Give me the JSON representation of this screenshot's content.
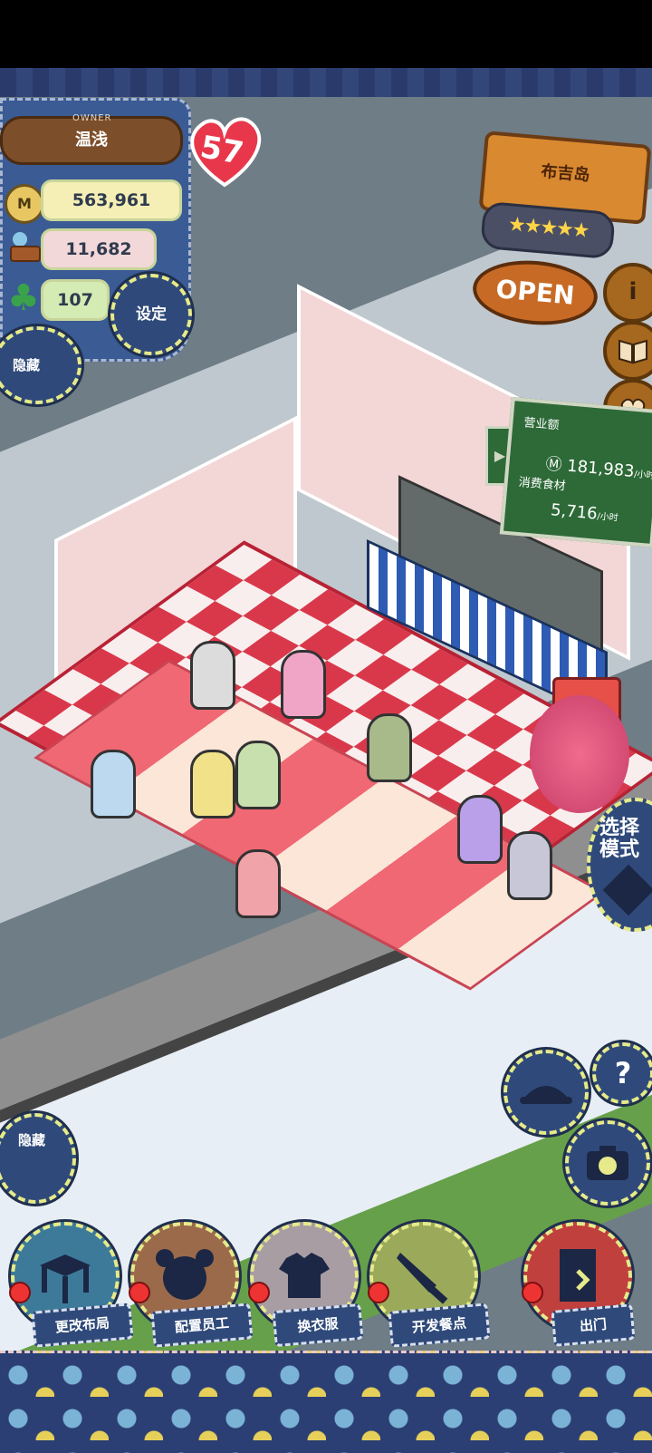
{
  "owner": {
    "label": "OWNER",
    "name": "温浅",
    "hearts": "57",
    "money": "563,961",
    "food": "11,682",
    "clover": "107"
  },
  "buttons": {
    "settings": "设定",
    "hide_top": "隐藏",
    "hide_bottom": "隐藏",
    "mode": "选择模式",
    "help": "?",
    "info": "i"
  },
  "shop": {
    "name": "布吉岛",
    "stars": "★★★★★",
    "status": "OPEN"
  },
  "stats_board": {
    "revenue_label": "营业额",
    "revenue_value": "181,983",
    "revenue_unit": "/小时",
    "food_label": "消费食材",
    "food_value": "5,716",
    "food_unit": "/小时"
  },
  "bottom_menu": [
    {
      "label": "更改布局",
      "icon": "table-icon",
      "color": "#3d7a9a"
    },
    {
      "label": "配置员工",
      "icon": "bear-head-icon",
      "color": "#9a6a4b"
    },
    {
      "label": "换衣服",
      "icon": "shirt-icon",
      "color": "#a89da3"
    },
    {
      "label": "开发餐点",
      "icon": "knife-icon",
      "color": "#9aaa5a"
    },
    {
      "label": "出门",
      "icon": "door-icon",
      "color": "#c0403d"
    }
  ],
  "icons": {
    "money": "m-coin-icon",
    "food": "food-basket-icon",
    "clover": "clover-icon",
    "book": "recipe-book-icon",
    "heart": "heart-speech-icon",
    "hat": "hat-icon",
    "camera": "camera-icon"
  }
}
